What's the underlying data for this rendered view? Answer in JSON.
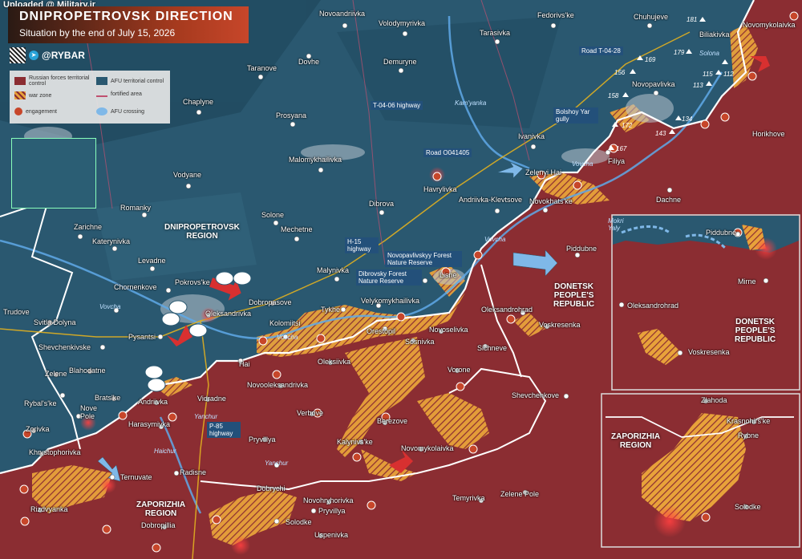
{
  "watermark": "Uploaded @ Military.ir",
  "header": {
    "title": "DNIPROPETROVSK DIRECTION",
    "subtitle": "Situation by the end of July 15, 2026"
  },
  "brand": {
    "handle": "@RYBAR"
  },
  "legend": {
    "russian": "Russian forces territorial control",
    "afu": "AFU territorial control",
    "war_zone": "war zone",
    "fortified": "fortified area",
    "engagement": "engagement",
    "crossing": "AFU crossing"
  },
  "colors": {
    "russian": "#8b2d32",
    "afu": "#2a5870",
    "war_zone": "#e8a23a",
    "accent": "#c7462a"
  },
  "regions": {
    "dnipro": "DNIPROPETROVSK\nREGION",
    "donetsk": "DONETSK\nPEOPLE'S\nREPUBLIC",
    "donetsk_inset": "DONETSK\nPEOPLE'S\nREPUBLIC",
    "zap": "ZAPORIZHIA\nREGION",
    "zap_inset": "ZAPORIZHIA\nREGION"
  },
  "roads": {
    "t0406": "T-04-06 highway",
    "o041405": "Road O041405",
    "t0428": "Road T-04-28",
    "h15": "H-15 highway",
    "p85": "P-85 highway"
  },
  "annotations": {
    "bolshoy": "Bolshoy Yar gully",
    "novopav_forest": "Novopavlivskyy Forest Nature Reserve",
    "dibrov_forest": "Dibrovsky Forest Nature Reserve"
  },
  "rivers": {
    "kamyanka": "Kam'yanka",
    "vovcha1": "Vovcha",
    "vovcha2": "Vovcha",
    "vovcha3": "Vovcha",
    "vovcha4": "Vovcha",
    "yanchur1": "Yanchur",
    "yanchur2": "Yanchur",
    "haichur": "Haichur",
    "mokri": "Mokri Yaly",
    "solona": "Solona"
  },
  "heights": {
    "h181": "181",
    "h179": "179",
    "h169": "169",
    "h115": "115",
    "h113": "113",
    "h112": "112",
    "h156": "156",
    "h158": "158",
    "h134": "134",
    "h172": "172",
    "h143": "143",
    "h167": "167"
  },
  "places": {
    "novoandriivka": "Novoandriivka",
    "volodymyrivka": "Volodymyrivka",
    "tarasivka": "Tarasivka",
    "fedorivske": "Fedorivs'ke",
    "chuhujeve": "Chuhujeve",
    "biliakivka": "Biliakivka",
    "novomykolaivka1": "Novomykolaivka",
    "dovhe": "Dovhe",
    "demuryne": "Demuryne",
    "taranove": "Taranove",
    "chaplyne": "Chaplyne",
    "prosyana": "Prosyana",
    "novopavlivka": "Novopavlivka",
    "horikhove": "Horikhove",
    "malomykhailivka": "Malomykhailivka",
    "ivanivka": "Ivanivka",
    "filiya": "Filiya",
    "vodyane": "Vodyane",
    "havrylivka": "Havrylivka",
    "zelenyi_hai": "Zelenyi Hai",
    "dachne": "Dachne",
    "romanky": "Romanky",
    "dibrova": "Dibrova",
    "solone": "Solone",
    "andriivka_klevtsove": "Andriivka-Klevtsove",
    "novokhatske": "Novokhats'ke",
    "zarichne": "Zarichne",
    "katerynivka": "Katerynivka",
    "mechetne": "Mechetne",
    "piddubne": "Piddubne",
    "piddubne_inset": "Piddubne",
    "levadne": "Levadne",
    "malynivka": "Malynivka",
    "pokrovske": "Pokrovs'ke",
    "chornenkove": "Chornenkove",
    "lisne": "Lisne",
    "trudove": "Trudove",
    "svitla_dolyna": "Svitla Dolyna",
    "dobropasove": "Dobropasove",
    "tykhe": "Tykhe",
    "velykomykhailivka": "Velykomykhailivka",
    "oleksandrivka": "Oleksandrivka",
    "kolomiitsi": "Kolomiitsi",
    "pysantsi": "Pysantsi",
    "orestopil": "Orestopil",
    "novoselivka": "Novoselivka",
    "oleksandrohrad": "Oleksandrohrad",
    "oleksandrohrad_inset": "Oleksandrohrad",
    "voskresenka": "Voskresenka",
    "voskresenka_inset": "Voskresenka",
    "mirne": "Mirne",
    "shevchenkivske": "Shevchenkivske",
    "sosnivka": "Sosnivka",
    "sichneve": "Sichneve",
    "hai": "Hai",
    "oleksiivka": "Oleksiivka",
    "blahodatne": "Blahodatne",
    "zelene": "Zelene",
    "vorone": "Vorone",
    "novooleksandrivka": "Novooleksandrivka",
    "shevchenkove": "Shevchenkove",
    "rybalske": "Rybal's'ke",
    "brats_ke": "Brats'ke",
    "andriivka": "Andriivka",
    "vidradne": "Vidradne",
    "verbove": "Verbove",
    "nove_pole": "Nove Pole",
    "zorivka": "Zorivka",
    "harasymivka": "Harasymivka",
    "berezove": "Berezove",
    "kalynivske": "Kalynivs'ke",
    "khrystophorivka": "Khrystophorivka",
    "pryvillya1": "Pryvillya",
    "novomykolaivka2": "Novomykolaivka",
    "zlahoda": "Zlahoda",
    "krasnohirske": "Krasnohirs'ke",
    "rybne": "Rybne",
    "ternuvate": "Ternuvate",
    "radisne": "Radisne",
    "dobrychi": "Dobrychi",
    "zelene_pole": "Zelene Pole",
    "temyrivka": "Temyrivka",
    "rizdvyanka": "Rizdvyanka",
    "novohryhorivka": "Novohryhorivka",
    "pryvillya2": "Pryvillya",
    "dobropillia": "Dobropillia",
    "solodke1": "Solodke",
    "solodke2": "Solodke",
    "uspenivka": "Uspenivka"
  }
}
